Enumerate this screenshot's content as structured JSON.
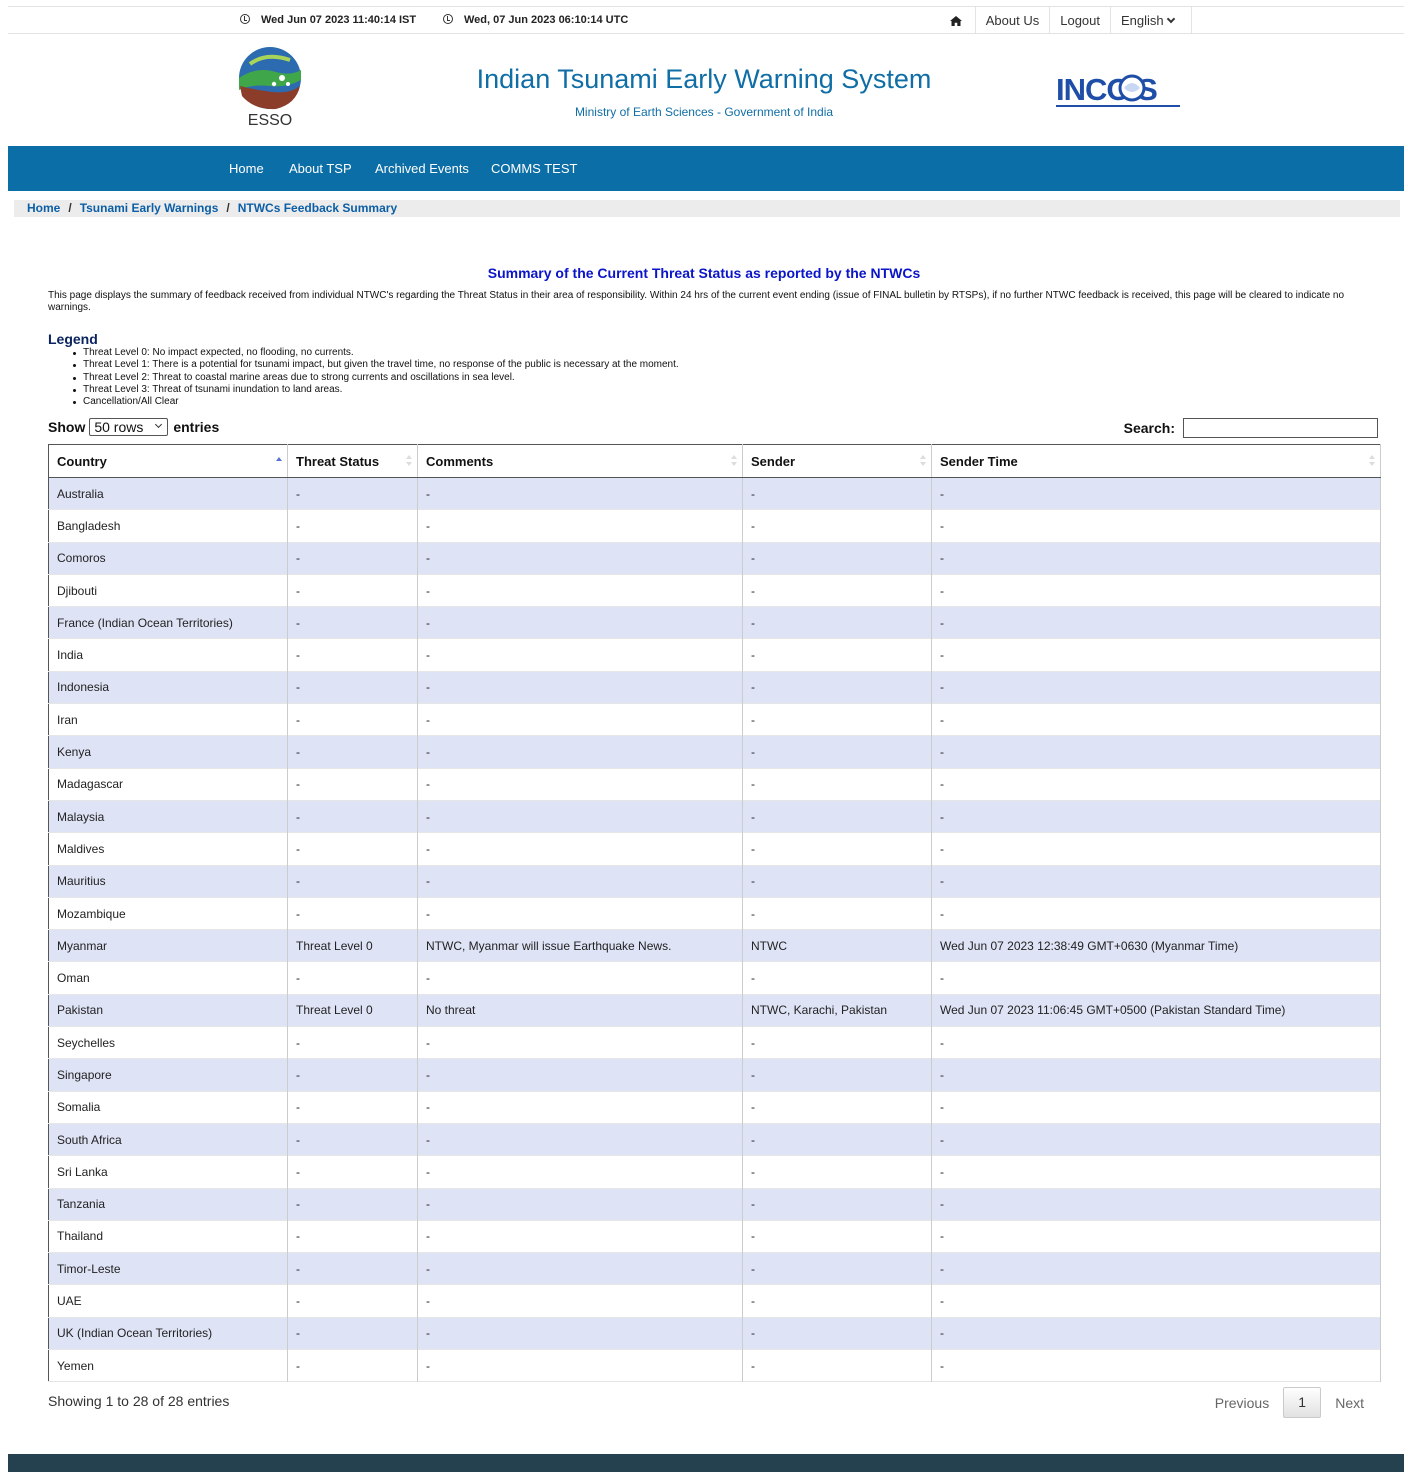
{
  "topbar": {
    "ist_time": "Wed Jun 07 2023 11:40:14 IST",
    "utc_time": "Wed, 07 Jun 2023 06:10:14 UTC",
    "links": {
      "about": "About Us",
      "logout": "Logout",
      "language": "English"
    }
  },
  "header": {
    "esso_label": "ESSO",
    "title": "Indian Tsunami Early Warning System",
    "subtitle": "Ministry of Earth Sciences - Government of India",
    "incois_label": "INCOIS"
  },
  "mainnav": {
    "items": [
      "Home",
      "About TSP",
      "Archived Events",
      "COMMS TEST"
    ]
  },
  "breadcrumb": [
    "Home",
    "Tsunami Early Warnings",
    "NTWCs Feedback Summary"
  ],
  "content": {
    "heading": "Summary of the Current Threat Status as reported by the NTWCs",
    "intro": "This page displays the summary of feedback received from individual NTWC's regarding the Threat Status in their area of responsibility. Within 24 hrs of the current event ending (issue of FINAL bulletin by RTSPs), if no further NTWC feedback is received, this page will be cleared to indicate no warnings.",
    "legend_title": "Legend",
    "legend": [
      "Threat Level 0: No impact expected, no flooding, no currents.",
      "Threat Level 1: There is a potential for tsunami impact, but given the travel time, no response of the public is necessary at the moment.",
      "Threat Level 2: Threat to coastal marine areas due to strong currents and oscillations in sea level.",
      "Threat Level 3: Threat of tsunami inundation to land areas.",
      "Cancellation/All Clear"
    ]
  },
  "controls": {
    "show_label": "Show",
    "rows_value": "50 rows",
    "entries_label": "entries",
    "search_label": "Search:",
    "search_value": ""
  },
  "table": {
    "columns": [
      "Country",
      "Threat Status",
      "Comments",
      "Sender",
      "Sender Time"
    ],
    "rows": [
      [
        "Australia",
        "-",
        "-",
        "-",
        "-"
      ],
      [
        "Bangladesh",
        "-",
        "-",
        "-",
        "-"
      ],
      [
        "Comoros",
        "-",
        "-",
        "-",
        "-"
      ],
      [
        "Djibouti",
        "-",
        "-",
        "-",
        "-"
      ],
      [
        "France (Indian Ocean Territories)",
        "-",
        "-",
        "-",
        "-"
      ],
      [
        "India",
        "-",
        "-",
        "-",
        "-"
      ],
      [
        "Indonesia",
        "-",
        "-",
        "-",
        "-"
      ],
      [
        "Iran",
        "-",
        "-",
        "-",
        "-"
      ],
      [
        "Kenya",
        "-",
        "-",
        "-",
        "-"
      ],
      [
        "Madagascar",
        "-",
        "-",
        "-",
        "-"
      ],
      [
        "Malaysia",
        "-",
        "-",
        "-",
        "-"
      ],
      [
        "Maldives",
        "-",
        "-",
        "-",
        "-"
      ],
      [
        "Mauritius",
        "-",
        "-",
        "-",
        "-"
      ],
      [
        "Mozambique",
        "-",
        "-",
        "-",
        "-"
      ],
      [
        "Myanmar",
        "Threat Level 0",
        "NTWC, Myanmar will issue Earthquake News.",
        "NTWC",
        "Wed Jun 07 2023 12:38:49 GMT+0630 (Myanmar Time)"
      ],
      [
        "Oman",
        "-",
        "-",
        "-",
        "-"
      ],
      [
        "Pakistan",
        "Threat Level 0",
        "No threat",
        "NTWC, Karachi, Pakistan",
        "Wed Jun 07 2023 11:06:45 GMT+0500 (Pakistan Standard Time)"
      ],
      [
        "Seychelles",
        "-",
        "-",
        "-",
        "-"
      ],
      [
        "Singapore",
        "-",
        "-",
        "-",
        "-"
      ],
      [
        "Somalia",
        "-",
        "-",
        "-",
        "-"
      ],
      [
        "South Africa",
        "-",
        "-",
        "-",
        "-"
      ],
      [
        "Sri Lanka",
        "-",
        "-",
        "-",
        "-"
      ],
      [
        "Tanzania",
        "-",
        "-",
        "-",
        "-"
      ],
      [
        "Thailand",
        "-",
        "-",
        "-",
        "-"
      ],
      [
        "Timor-Leste",
        "-",
        "-",
        "-",
        "-"
      ],
      [
        "UAE",
        "-",
        "-",
        "-",
        "-"
      ],
      [
        "UK (Indian Ocean Territories)",
        "-",
        "-",
        "-",
        "-"
      ],
      [
        "Yemen",
        "-",
        "-",
        "-",
        "-"
      ]
    ]
  },
  "footer_info": {
    "showing": "Showing 1 to 28 of 28 entries",
    "previous": "Previous",
    "current_page": "1",
    "next": "Next"
  },
  "colors": {
    "nav_blue": "#0c6ea6",
    "row_stripe": "#dfe3f6",
    "heading_blue": "#0a14c8",
    "footer": "#25414f"
  }
}
